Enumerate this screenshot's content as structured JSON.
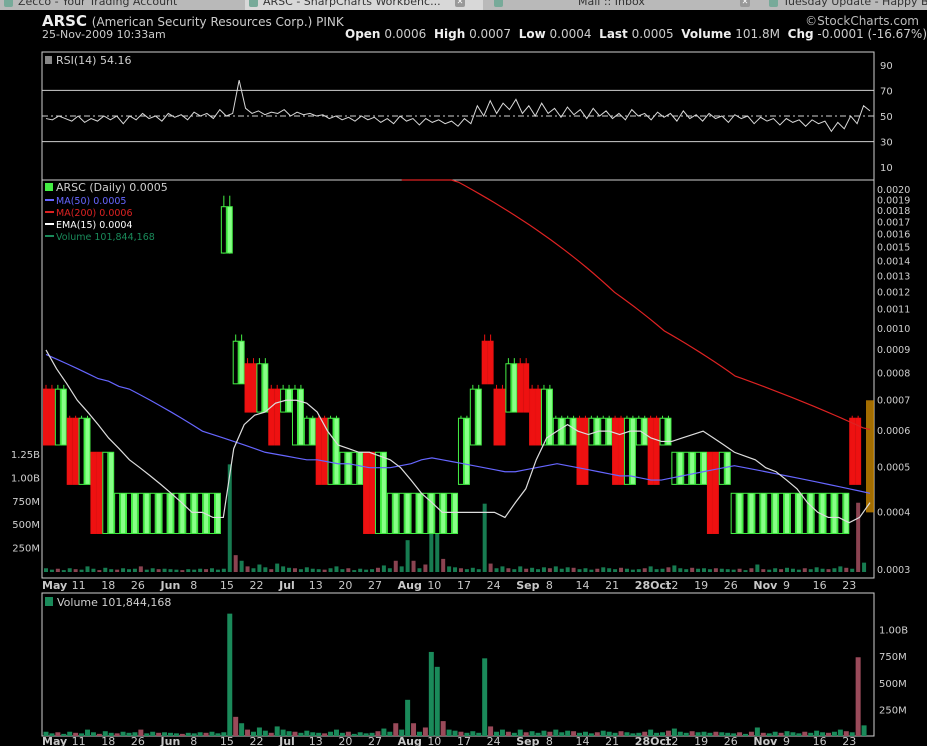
{
  "browser": {
    "tabs": [
      {
        "label": "Zecco - Your Trading Account",
        "active": false
      },
      {
        "label": "ARSC - SharpCharts Workbenc...",
        "active": true
      },
      {
        "label": "Mail :: Inbox",
        "active": false
      },
      {
        "label": "Tuesday Update - Happy Bir",
        "active": false
      }
    ]
  },
  "header": {
    "symbol": "ARSC",
    "company": "(American Security Resources Corp.) PINK",
    "date_time": "25-Nov-2009 10:33am",
    "logo": "©StockCharts.com",
    "quote": {
      "open_label": "Open",
      "open": "0.0006",
      "high_label": "High",
      "high": "0.0007",
      "low_label": "Low",
      "low": "0.0004",
      "last_label": "Last",
      "last": "0.0005",
      "volume_label": "Volume",
      "volume": "101.8M",
      "chg_label": "Chg",
      "chg": "-0.0001 (-16.67%)"
    }
  },
  "colors": {
    "up": "#44ee44",
    "up_fill": "#000000",
    "down": "#ee1111",
    "ma50": "#6666ff",
    "ma200": "#dd2222",
    "ema15": "#dddddd",
    "volume_up": "#1a8a5a",
    "volume_down": "#9a4a5a",
    "highlight": "#cc8800"
  },
  "chart_data": [
    {
      "type": "line",
      "panel": "rsi",
      "legend": "RSI(14) 54.16",
      "ylim": [
        0,
        100
      ],
      "ticks": [
        "90",
        "70",
        "50",
        "30",
        "10"
      ],
      "tick_values": [
        90,
        70,
        50,
        30,
        10
      ],
      "reference_lines": [
        70,
        50,
        30
      ],
      "values": [
        48,
        47,
        50,
        48,
        46,
        50,
        45,
        48,
        46,
        50,
        47,
        50,
        44,
        50,
        47,
        52,
        48,
        50,
        46,
        52,
        49,
        51,
        47,
        53,
        50,
        52,
        48,
        55,
        50,
        52,
        78,
        56,
        52,
        54,
        51,
        53,
        52,
        55,
        50,
        53,
        51,
        52,
        50,
        51,
        48,
        50,
        47,
        49,
        46,
        50,
        47,
        49,
        45,
        48,
        44,
        50,
        46,
        48,
        43,
        48,
        45,
        47,
        44,
        46,
        42,
        48,
        44,
        58,
        50,
        62,
        52,
        60,
        55,
        63,
        52,
        58,
        50,
        60,
        52,
        56,
        49,
        57,
        51,
        55,
        48,
        56,
        50,
        54,
        48,
        52,
        47,
        55,
        50,
        52,
        47,
        53,
        49,
        52,
        46,
        54,
        48,
        51,
        46,
        52,
        48,
        50,
        45,
        51,
        48,
        50,
        44,
        49,
        46,
        48,
        43,
        48,
        45,
        47,
        42,
        47,
        44,
        46,
        38,
        45,
        40,
        50,
        44,
        58,
        54
      ]
    },
    {
      "type": "line",
      "panel": "price",
      "scale": "log",
      "legend": {
        "symbol": "ARSC (Daily) 0.0005",
        "ma50": "MA(50) 0.0005",
        "ma200": "MA(200) 0.0006",
        "ema15": "EMA(15) 0.0004",
        "volume": "Volume 101,844,168"
      },
      "ylim": [
        0.0003,
        0.002
      ],
      "price_ticks": [
        "0.0020",
        "0.0019",
        "0.0018",
        "0.0017",
        "0.0016",
        "0.0015",
        "0.0014",
        "0.0013",
        "0.0012",
        "0.0011",
        "0.0010",
        "0.0009",
        "0.0008",
        "0.0007",
        "0.0006",
        "0.0005",
        "0.0004",
        "0.0003"
      ],
      "price_tick_values": [
        0.002,
        0.0019,
        0.0018,
        0.0017,
        0.0016,
        0.0015,
        0.0014,
        0.0013,
        0.0012,
        0.0011,
        0.001,
        0.0009,
        0.0008,
        0.0007,
        0.0006,
        0.0005,
        0.0004,
        0.0003
      ],
      "volume_overlay_ticks": [
        "1.25B",
        "1.00B",
        "750M",
        "500M",
        "250M"
      ],
      "volume_overlay_values": [
        1250,
        1000,
        750,
        500,
        250
      ],
      "x_labels": [
        "May",
        "11",
        "18",
        "26",
        "Jun",
        "8",
        "15",
        "22",
        "Jul",
        "13",
        "20",
        "27",
        "Aug",
        "10",
        "17",
        "24",
        "Sep",
        "8",
        "14",
        "21",
        "28Oct",
        "12",
        "19",
        "26",
        "Nov",
        "9",
        "16",
        "23"
      ],
      "x_label_index": [
        0,
        5,
        10,
        15,
        20,
        25,
        30,
        35,
        40,
        45,
        50,
        55,
        60,
        65,
        70,
        75,
        80,
        85,
        90,
        95,
        100,
        105,
        110,
        115,
        120,
        125,
        130,
        135
      ],
      "x_label_bold": [
        0,
        4,
        8,
        12,
        16,
        20,
        24
      ],
      "ma200": [
        0.0024,
        0.00236,
        0.00232,
        0.00228,
        0.00224,
        0.0022,
        0.00216,
        0.00212,
        0.00208,
        0.00204,
        0.002,
        0.00196,
        0.00192,
        0.00188,
        0.00184,
        0.0018,
        0.00176,
        0.00172,
        0.00168,
        0.00164,
        0.0016,
        0.00156,
        0.00152,
        0.00148,
        0.00144,
        0.0014,
        0.00136,
        0.00132,
        0.00128,
        0.00124,
        0.0012,
        0.00117,
        0.00114,
        0.00111,
        0.00108,
        0.00105,
        0.00102,
        0.00099,
        0.00097,
        0.00095,
        0.00093,
        0.00091,
        0.00089,
        0.00087,
        0.00085,
        0.00083,
        0.00081,
        0.00079,
        0.00078,
        0.00077,
        0.00076,
        0.00075,
        0.00074,
        0.00073,
        0.00072,
        0.00071,
        0.0007,
        0.00069,
        0.00068,
        0.00067,
        0.00066,
        0.00065,
        0.00064,
        0.00063,
        0.00062,
        0.00061,
        0.000605
      ],
      "ma200_start_index": 74,
      "ma50": [
        0.00088,
        0.00086,
        0.00084,
        0.00082,
        0.0008,
        0.00078,
        0.00077,
        0.00075,
        0.00074,
        0.00072,
        0.0007,
        0.00068,
        0.00066,
        0.00064,
        0.00062,
        0.0006,
        0.00059,
        0.00058,
        0.00057,
        0.00056,
        0.00055,
        0.00054,
        0.000535,
        0.00053,
        0.000525,
        0.00052,
        0.00052,
        0.000515,
        0.00051,
        0.00051,
        0.000505,
        0.0005,
        0.0005,
        0.0005,
        0.000505,
        0.00051,
        0.00052,
        0.000525,
        0.00052,
        0.000515,
        0.00051,
        0.000505,
        0.0005,
        0.000495,
        0.00049,
        0.00049,
        0.000495,
        0.0005,
        0.000505,
        0.00051,
        0.000505,
        0.0005,
        0.000495,
        0.00049,
        0.000485,
        0.00048,
        0.00048,
        0.000475,
        0.00047,
        0.00047,
        0.000475,
        0.00048,
        0.000485,
        0.00049,
        0.000495,
        0.0005,
        0.000505,
        0.0005,
        0.000495,
        0.00049,
        0.000485,
        0.00048,
        0.000475,
        0.00047,
        0.000465,
        0.00046,
        0.000455,
        0.00045,
        0.000445,
        0.00044
      ],
      "ema15": [
        0.0009,
        0.00082,
        0.00076,
        0.0007,
        0.00066,
        0.00062,
        0.00058,
        0.00055,
        0.00052,
        0.0005,
        0.00048,
        0.00046,
        0.00044,
        0.00042,
        0.0004,
        0.0004,
        0.00039,
        0.00039,
        0.00055,
        0.00062,
        0.00065,
        0.00066,
        0.00069,
        0.0007,
        0.0007,
        0.00069,
        0.00066,
        0.0006,
        0.00056,
        0.00055,
        0.00054,
        0.00054,
        0.00053,
        0.00052,
        0.0005,
        0.00047,
        0.00044,
        0.00042,
        0.0004,
        0.0004,
        0.0004,
        0.0004,
        0.0004,
        0.0004,
        0.00039,
        0.00042,
        0.00045,
        0.00052,
        0.00058,
        0.0006,
        0.00062,
        0.0006,
        0.00059,
        0.0006,
        0.0006,
        0.00059,
        0.0006,
        0.0006,
        0.00058,
        0.00057,
        0.00057,
        0.00058,
        0.00059,
        0.0006,
        0.00058,
        0.00056,
        0.00054,
        0.00053,
        0.00052,
        0.0005,
        0.00049,
        0.00047,
        0.00045,
        0.00042,
        0.0004,
        0.00039,
        0.00039,
        0.00038,
        0.00039,
        0.00042
      ],
      "candles_sample": {
        "index": [
          0,
          2,
          4,
          6,
          8,
          10,
          12,
          14,
          16,
          18,
          20,
          22,
          24,
          26,
          28,
          30,
          32,
          34,
          36,
          38,
          40,
          42,
          44,
          46,
          48,
          50,
          52,
          54,
          56,
          58,
          60,
          62,
          64,
          66,
          68,
          70,
          72,
          74,
          76,
          78,
          80,
          82,
          84,
          86,
          88,
          90,
          92,
          94,
          96,
          98,
          100,
          102,
          104,
          106,
          108,
          110,
          112,
          114,
          116,
          118,
          120,
          122,
          124,
          126,
          128,
          130,
          132,
          134,
          136
        ],
        "open": [
          0.0007,
          0.0006,
          0.0006,
          0.0005,
          0.0005,
          0.0004,
          0.0004,
          0.0004,
          0.0004,
          0.0004,
          0.0004,
          0.0004,
          0.0004,
          0.0004,
          0.0004,
          0.0015,
          0.0008,
          0.0008,
          0.0007,
          0.0007,
          0.0007,
          0.0006,
          0.0006,
          0.0006,
          0.0005,
          0.0005,
          0.0005,
          0.0005,
          0.0004,
          0.0004,
          0.0004,
          0.0004,
          0.0004,
          0.0004,
          0.0004,
          0.0005,
          0.0006,
          0.0009,
          0.0007,
          0.0007,
          0.0008,
          0.0007,
          0.0006,
          0.0006,
          0.0006,
          0.0006,
          0.0006,
          0.0006,
          0.0006,
          0.0005,
          0.0006,
          0.0006,
          0.0006,
          0.0005,
          0.0005,
          0.0005,
          0.0005,
          0.0005,
          0.0004,
          0.0004,
          0.0004,
          0.0004,
          0.0004,
          0.0004,
          0.0004,
          0.0004,
          0.0004,
          0.0004,
          0.0006
        ],
        "close": [
          0.0006,
          0.0007,
          0.0005,
          0.0006,
          0.0004,
          0.0005,
          0.0004,
          0.0004,
          0.0004,
          0.0004,
          0.0004,
          0.0004,
          0.0004,
          0.0004,
          0.0004,
          0.0018,
          0.0009,
          0.0007,
          0.0008,
          0.0006,
          0.0007,
          0.0007,
          0.0006,
          0.0005,
          0.0006,
          0.0005,
          0.0005,
          0.0004,
          0.0005,
          0.0004,
          0.0004,
          0.0004,
          0.0004,
          0.0004,
          0.0004,
          0.0006,
          0.0007,
          0.0008,
          0.0006,
          0.0008,
          0.0007,
          0.0006,
          0.0007,
          0.0006,
          0.0006,
          0.0005,
          0.0006,
          0.0006,
          0.0005,
          0.0006,
          0.0006,
          0.0005,
          0.0006,
          0.0005,
          0.0005,
          0.0005,
          0.0004,
          0.0005,
          0.0004,
          0.0004,
          0.0004,
          0.0004,
          0.0004,
          0.0004,
          0.0004,
          0.0004,
          0.0004,
          0.0004,
          0.0005
        ]
      }
    },
    {
      "type": "bar",
      "panel": "volume",
      "legend": "Volume 101,844,168",
      "ylim": [
        0,
        1250
      ],
      "ticks": [
        "1.00B",
        "750M",
        "500M",
        "250M"
      ],
      "tick_values": [
        1000,
        750,
        500,
        250
      ],
      "unit": "millions",
      "x_labels": [
        "May",
        "11",
        "18",
        "26",
        "Jun",
        "8",
        "15",
        "22",
        "Jul",
        "13",
        "20",
        "27",
        "Aug",
        "10",
        "17",
        "24",
        "Sep",
        "8",
        "14",
        "21",
        "28Oct",
        "12",
        "19",
        "26",
        "Nov",
        "9",
        "16",
        "23"
      ],
      "values": [
        40,
        25,
        35,
        20,
        40,
        30,
        25,
        60,
        35,
        20,
        45,
        30,
        25,
        40,
        30,
        35,
        60,
        25,
        40,
        30,
        35,
        30,
        25,
        20,
        30,
        25,
        35,
        30,
        40,
        25,
        35,
        1150,
        180,
        120,
        60,
        40,
        80,
        50,
        30,
        90,
        60,
        45,
        40,
        30,
        50,
        35,
        30,
        25,
        40,
        60,
        30,
        40,
        20,
        35,
        25,
        30,
        45,
        70,
        40,
        120,
        60,
        340,
        120,
        40,
        80,
        790,
        650,
        140,
        60,
        50,
        40,
        30,
        45,
        30,
        730,
        90,
        40,
        60,
        40,
        30,
        60,
        35,
        45,
        30,
        50,
        40,
        60,
        35,
        50,
        45,
        30,
        40,
        25,
        35,
        50,
        40,
        30,
        45,
        35,
        25,
        30,
        40,
        60,
        30,
        35,
        50,
        70,
        40,
        30,
        45,
        35,
        40,
        30,
        40,
        35,
        30,
        25,
        35,
        20,
        40,
        80,
        30,
        25,
        40,
        30,
        45,
        35,
        25,
        40,
        30,
        50,
        35,
        30,
        40,
        60,
        45,
        35,
        740,
        100
      ],
      "down_days": [
        2,
        5,
        9,
        12,
        16,
        19,
        23,
        27,
        32,
        34,
        38,
        42,
        47,
        51,
        56,
        59,
        62,
        64,
        67,
        70,
        75,
        78,
        81,
        85,
        89,
        93,
        97,
        101,
        105,
        109,
        113,
        117,
        119,
        121,
        124,
        128,
        132,
        135,
        137
      ]
    }
  ]
}
